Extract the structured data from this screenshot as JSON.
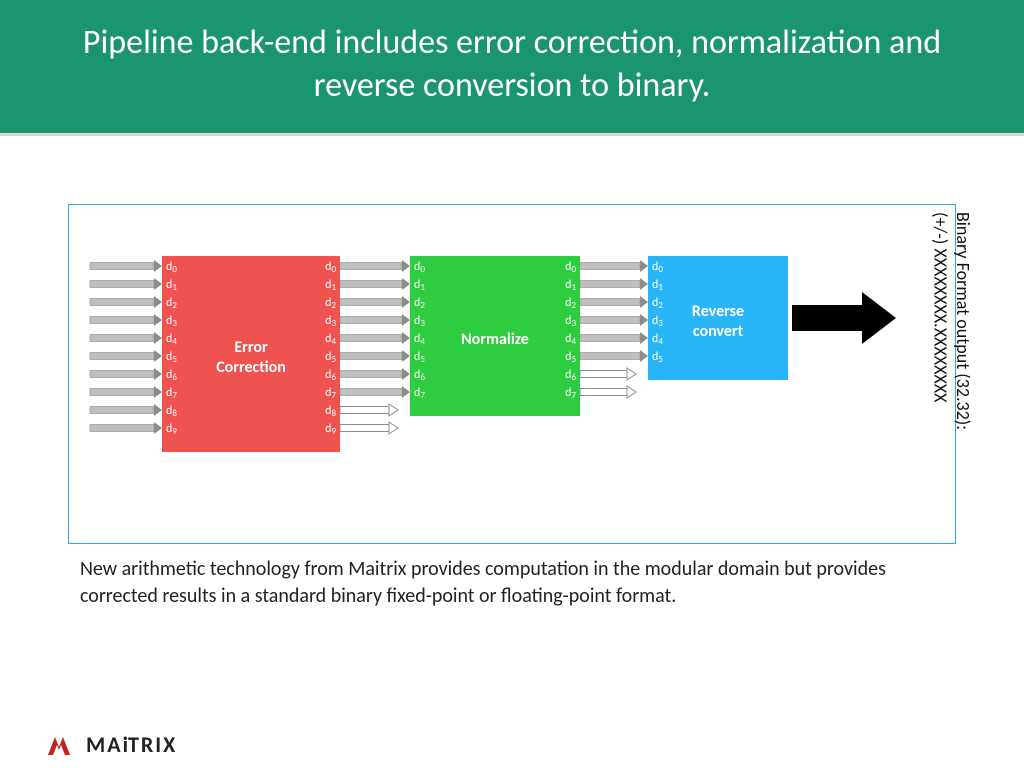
{
  "header": {
    "title": "Pipeline back-end includes error correction, normalization and reverse conversion to binary."
  },
  "colors": {
    "header_bg": "#1b9471",
    "error_block": "#ef5350",
    "normalize_block": "#2ecc40",
    "reverse_block": "#29b6f6",
    "border": "#2aa8e0"
  },
  "blocks": {
    "error": {
      "label_line1": "Error",
      "label_line2": "Correction",
      "digits_in": 10,
      "digits_out": 10
    },
    "normalize": {
      "label_line1": "Normalize",
      "digits_in": 8,
      "digits_out": 8
    },
    "reverse": {
      "label_line1": "Reverse",
      "label_line2": "convert",
      "digits_in": 6
    }
  },
  "digit_prefix": "d",
  "output": {
    "line1": "Binary Format output (32.32):",
    "line2": "(+/-) XXXXXXXX.XXXXXXXX"
  },
  "caption": "New arithmetic technology from Maitrix provides computation in the modular domain but provides corrected results in a standard binary fixed-point or floating-point format.",
  "logo": {
    "text": "MAiTRIX",
    "mark_color": "#c2221f"
  }
}
